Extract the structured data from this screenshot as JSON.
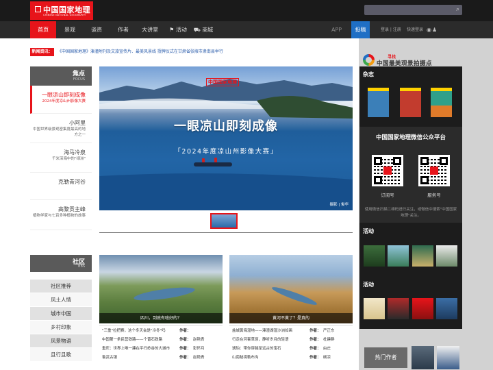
{
  "header": {
    "logo_cn": "中国国家地理",
    "logo_en": "CHINESE NATIONAL GEOGRAPHY",
    "search_placeholder": ""
  },
  "nav": {
    "items": [
      "首页",
      "景观",
      "谈资",
      "作者",
      "大讲堂",
      "活动",
      "商城"
    ],
    "app": "APP",
    "cn": "投稿",
    "login": "登录 | 注册",
    "quick_login": "快速登录"
  },
  "news": {
    "tag": "新闻资讯：",
    "text": "《中国国家地理》溱潼附刊及文旅宣传片、最美风景线 授牌仪式在甘肃省张掖市肃南县举行"
  },
  "focus": {
    "title": "焦点",
    "sub": "FOCUS",
    "items": [
      {
        "title": "一眼凉山即刻成像",
        "sub": "2024年度凉山州影像大赛"
      },
      {
        "title": "小阿里",
        "sub": "中国世界级景观密集度最高的地方之一"
      },
      {
        "title": "海马冷泉",
        "sub": "千米深海中的\"绿洲\""
      },
      {
        "title": "克勒青河谷",
        "sub": ""
      },
      {
        "title": "高黎贡主峰",
        "sub": "植物学家与七百多种植物的故事"
      }
    ]
  },
  "hero": {
    "brand": "中国国家地理",
    "title": "一眼凉山即刻成像",
    "subtitle": "「2024年度凉山州影像大赛」",
    "credit": "摄影 | 俊华"
  },
  "bbs": {
    "title": "社区",
    "sub": "BBS",
    "items": [
      "社区推荐",
      "风土人情",
      "城市中国",
      "乡村印象",
      "风景物语",
      "且行且歌"
    ]
  },
  "cards": [
    {
      "caption": "四川，到底有啥好的？"
    },
    {
      "caption": "黄河不黄了？是真的"
    }
  ],
  "card_texts": [
    {
      "title": "\"三重\"拉把赛，这个冬天会是\"冷冬\"吗",
      "label": "作者：",
      "author": ""
    },
    {
      "title": "中国第一条民营铁路——个晋石铁路",
      "label": "作者：",
      "author": "赵艳青"
    },
    {
      "title": "重庆：世界上唯一建在平行岭谷的大城市",
      "label": "作者：",
      "author": "彭怀月"
    },
    {
      "title": "鲁武古镇",
      "label": "作者：",
      "author": "赵艳青"
    },
    {
      "title": "盐城黄海湿地——溱潼湖湿沙洲如画",
      "label": "作者：",
      "author": "严正东"
    },
    {
      "title": "行走在河套草原，静听岁月的轻语",
      "label": "作者：",
      "author": "杜建群"
    },
    {
      "title": "琥珀：带你穿越至远古的宝石",
      "label": "作者：",
      "author": "由庄"
    },
    {
      "title": "山南秘境勒布沟",
      "label": "作者：",
      "author": "碗凉"
    }
  ],
  "right": {
    "logo_top": "寻找",
    "logo_main": "中国最美观景拍摄点",
    "magazine": "杂志",
    "wechat_title": "中国国家地理微信公众平台",
    "qr1_label": "订阅号",
    "qr2_label": "服务号",
    "wechat_desc": "使用微信扫描二维码进行关注，或微信中搜索\"中国国家地理\"关注。",
    "activity1": "活动",
    "activity2": "活动",
    "hot_authors": "热门作者"
  },
  "colors": {
    "brand_red": "#e7141a",
    "nav_dark": "#2b2b2b",
    "link_blue": "#2a5cab",
    "accent_blue": "#1f6fc5"
  }
}
